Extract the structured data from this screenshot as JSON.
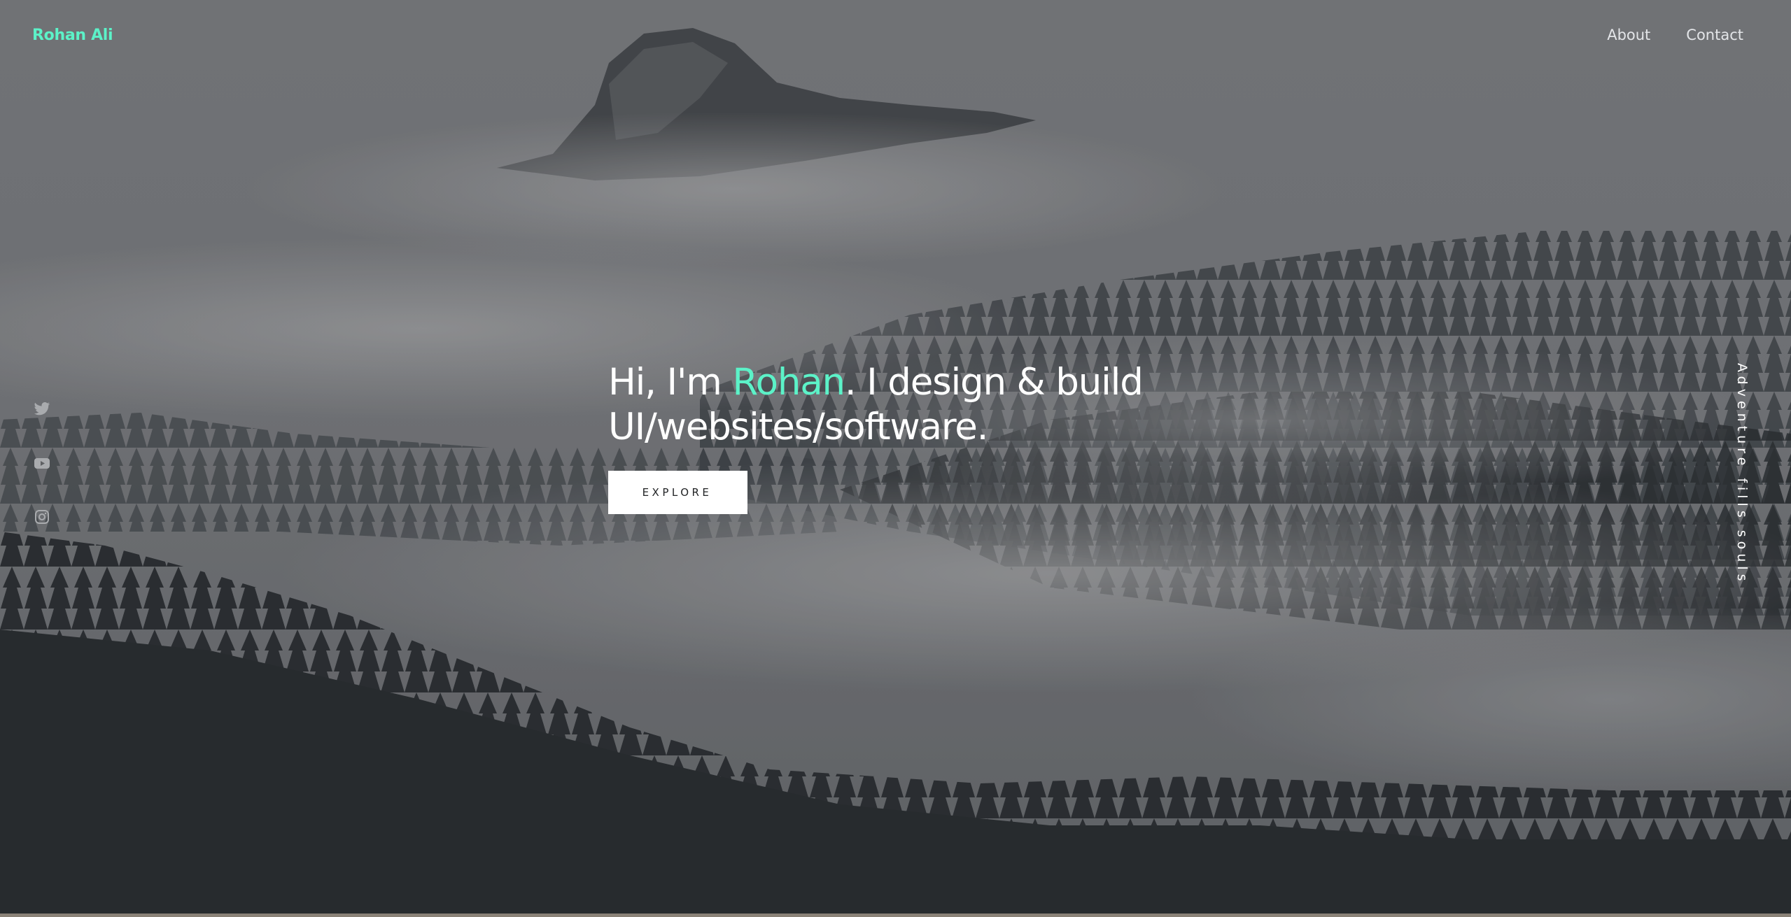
{
  "brand": {
    "name": "Rohan Ali"
  },
  "nav": {
    "links": [
      {
        "label": "About"
      },
      {
        "label": "Contact"
      }
    ]
  },
  "social": [
    {
      "icon": "twitter-icon"
    },
    {
      "icon": "youtube-icon"
    },
    {
      "icon": "instagram-icon"
    }
  ],
  "hero": {
    "greeting": "Hi, I'm ",
    "name": "Rohan",
    "line1_rest": ". I design & build",
    "line2": "UI/websites/software.",
    "button_label": "EXPLORE"
  },
  "tagline": "Adventure fills souls",
  "colors": {
    "accent": "#5cf2c8",
    "text": "#ffffff",
    "nav_text": "#e3e5e8",
    "background": "#6b6d70"
  }
}
